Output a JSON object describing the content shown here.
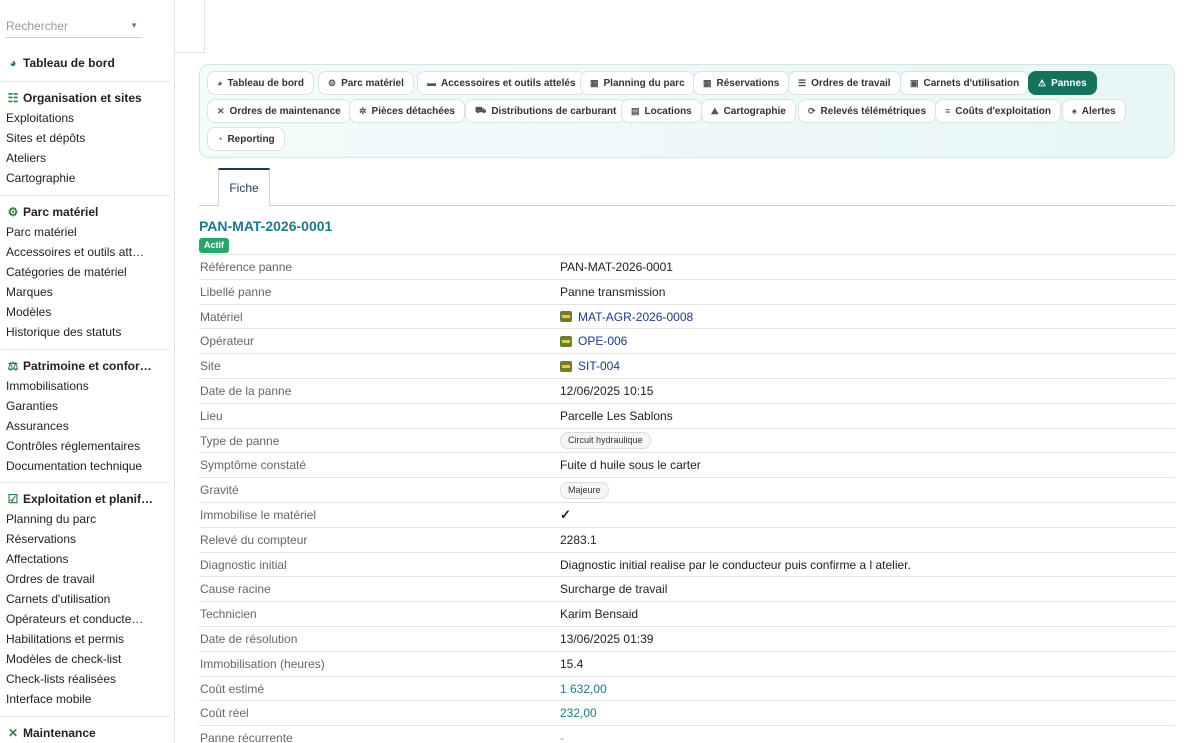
{
  "sidebar": {
    "search_placeholder": "Rechercher",
    "top_item": "Tableau de bord",
    "sections": [
      {
        "title": "Organisation et sites",
        "items": [
          "Exploitations",
          "Sites et dépôts",
          "Ateliers",
          "Cartographie"
        ]
      },
      {
        "title": "Parc matériel",
        "items": [
          "Parc matériel",
          "Accessoires et outils attel…",
          "Catégories de matériel",
          "Marques",
          "Modèles",
          "Historique des statuts"
        ]
      },
      {
        "title": "Patrimoine et confor…",
        "items": [
          "Immobilisations",
          "Garanties",
          "Assurances",
          "Contrôles réglementaires",
          "Documentation technique"
        ]
      },
      {
        "title": "Exploitation et planif…",
        "items": [
          "Planning du parc",
          "Réservations",
          "Affectations",
          "Ordres de travail",
          "Carnets d'utilisation",
          "Opérateurs et conducteurs",
          "Habilitations et permis",
          "Modèles de check-list",
          "Check-lists réalisées",
          "Interface mobile"
        ]
      },
      {
        "title": "Maintenance",
        "items": []
      }
    ]
  },
  "nav": {
    "pills": [
      "Tableau de bord",
      "Parc matériel",
      "Accessoires et outils attelés",
      "Planning du parc",
      "Réservations",
      "Ordres de travail",
      "Carnets d'utilisation",
      "Pannes",
      "Ordres de maintenance",
      "Pièces détachées",
      "Distributions de carburant",
      "Locations",
      "Cartographie",
      "Relevés télémétriques",
      "Coûts d'exploitation",
      "Alertes",
      "Reporting"
    ],
    "active": "Pannes"
  },
  "tabs": {
    "fiche": "Fiche"
  },
  "record": {
    "title": "PAN-MAT-2026-0001",
    "status": "Actif",
    "fields": [
      {
        "label": "Référence panne",
        "value": "PAN-MAT-2026-0001"
      },
      {
        "label": "Libellé panne",
        "value": "Panne transmission"
      },
      {
        "label": "Matériel",
        "value": "MAT-AGR-2026-0008"
      },
      {
        "label": "Opérateur",
        "value": "OPE-006"
      },
      {
        "label": "Site",
        "value": "SIT-004"
      },
      {
        "label": "Date de la panne",
        "value": "12/06/2025 10:15"
      },
      {
        "label": "Lieu",
        "value": "Parcelle Les Sablons"
      },
      {
        "label": "Type de panne",
        "value": "Circuit hydraulique"
      },
      {
        "label": "Symptôme constaté",
        "value": "Fuite d huile sous le carter"
      },
      {
        "label": "Gravité",
        "value": "Majeure"
      },
      {
        "label": "Immobilise le matériel",
        "value": "✓"
      },
      {
        "label": "Relevé du compteur",
        "value": "2283.1"
      },
      {
        "label": "Diagnostic initial",
        "value": "Diagnostic initial realise par le conducteur puis confirme a l atelier."
      },
      {
        "label": "Cause racine",
        "value": "Surcharge de travail"
      },
      {
        "label": "Technicien",
        "value": "Karim Bensaid"
      },
      {
        "label": "Date de résolution",
        "value": "13/06/2025 01:39"
      },
      {
        "label": "Immobilisation (heures)",
        "value": "15.4"
      },
      {
        "label": "Coût estimé",
        "value": "1 632,00"
      },
      {
        "label": "Coût réel",
        "value": "232,00"
      },
      {
        "label": "Panne récurrente",
        "value": "-"
      }
    ]
  }
}
